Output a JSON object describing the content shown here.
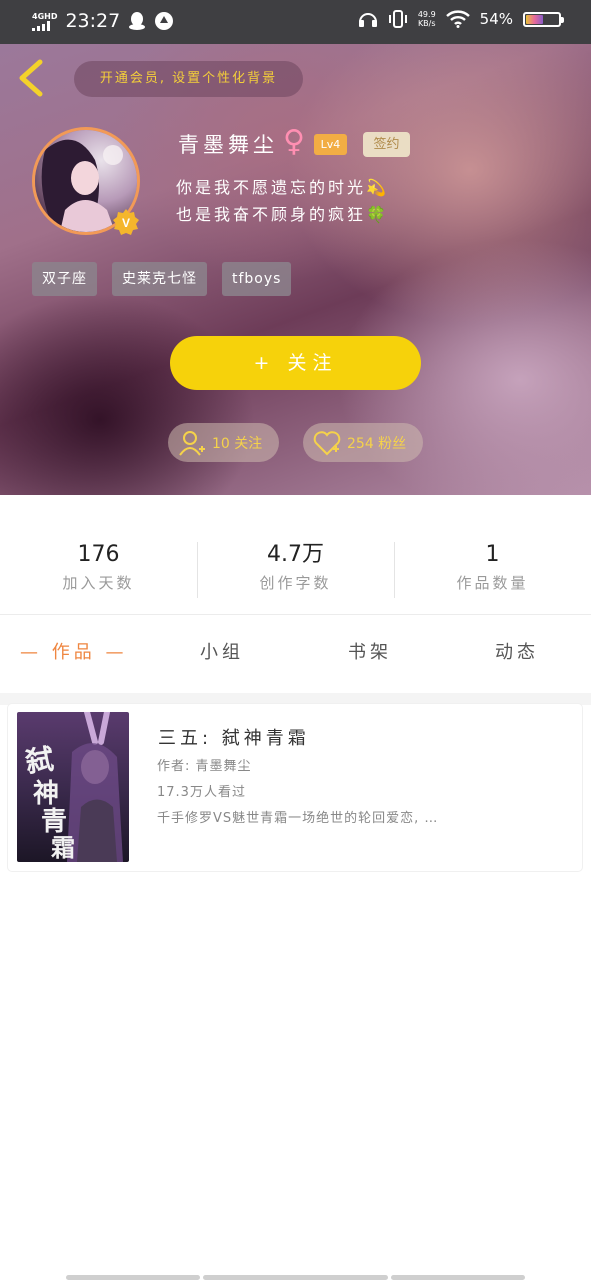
{
  "status_bar": {
    "network": "4GHD",
    "time": "23:27",
    "speed_value": "49.9",
    "speed_unit": "KB/s",
    "battery_percent": "54%",
    "battery_level": 0.54
  },
  "header": {
    "vip_prompt": "开通会员, 设置个性化背景",
    "username": "青墨舞尘",
    "gender_symbol": "♀",
    "level": "Lv4",
    "signed_badge": "签约",
    "bio_line1": "你是我不愿遗忘的时光💫",
    "bio_line2": "也是我奋不顾身的疯狂🍀",
    "vip_badge": "V",
    "tags": [
      "双子座",
      "史莱克七怪",
      "tfboys"
    ],
    "follow_button": "+ 关注",
    "following_label": "10 关注",
    "followers_label": "254 粉丝"
  },
  "stats": [
    {
      "value": "176",
      "label": "加入天数"
    },
    {
      "value": "4.7万",
      "label": "创作字数"
    },
    {
      "value": "1",
      "label": "作品数量"
    }
  ],
  "tabs": [
    {
      "label": "— 作品 —",
      "active": true
    },
    {
      "label": "小组",
      "active": false
    },
    {
      "label": "书架",
      "active": false
    },
    {
      "label": "动态",
      "active": false
    }
  ],
  "works": [
    {
      "title": "三五: 弑神青霜",
      "author": "作者: 青墨舞尘",
      "views": "17.3万人看过",
      "summary": "千手修罗VS魅世青霜一场绝世的轮回爱恋, …",
      "cover_text": "弑神青霜"
    }
  ],
  "colors": {
    "accent_yellow": "#f6d20b",
    "active_tab": "#ef8640",
    "pill_text": "#f5d24a"
  }
}
